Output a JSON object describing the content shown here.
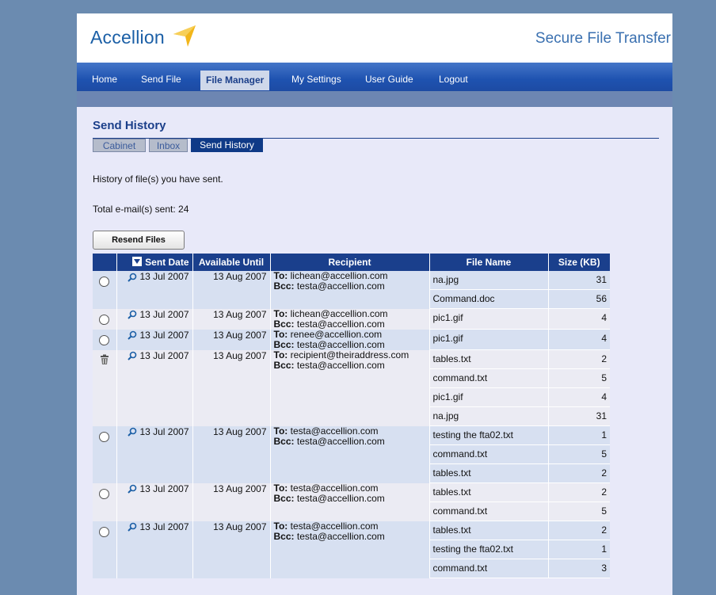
{
  "header": {
    "logo_text": "Accellion",
    "app_title": "Secure File Transfer",
    "brand_blue": "#1b5fa6",
    "logo_accent": "#f2b61a"
  },
  "nav": {
    "items": [
      {
        "label": "Home"
      },
      {
        "label": "Send File"
      },
      {
        "label": "File Manager",
        "active": true
      },
      {
        "label": "My Settings"
      },
      {
        "label": "User Guide"
      },
      {
        "label": "Logout"
      }
    ]
  },
  "page": {
    "title": "Send History",
    "tabs": [
      {
        "label": "Cabinet"
      },
      {
        "label": "Inbox"
      },
      {
        "label": "Send History",
        "active": true
      }
    ],
    "description": "History of file(s) you have sent.",
    "total_label": "Total e-mail(s) sent: 24",
    "resend_label": "Resend Files"
  },
  "table": {
    "columns": {
      "sent_date": "Sent Date",
      "available_until": "Available Until",
      "recipient": "Recipient",
      "file_name": "File Name",
      "size": "Size (KB)"
    },
    "sort_icon": "sort-down-icon",
    "to_label": "To:",
    "bcc_label": "Bcc:",
    "records": [
      {
        "selector": "radio",
        "sent": "13 Jul 2007",
        "available": "13 Aug 2007",
        "to": "lichean@accellion.com",
        "bcc": "testa@accellion.com",
        "files": [
          {
            "name": "na.jpg",
            "size": "31"
          },
          {
            "name": "Command.doc",
            "size": "56"
          }
        ]
      },
      {
        "selector": "radio",
        "sent": "13 Jul 2007",
        "available": "13 Aug 2007",
        "to": "lichean@accellion.com",
        "bcc": "testa@accellion.com",
        "files": [
          {
            "name": "pic1.gif",
            "size": "4"
          }
        ]
      },
      {
        "selector": "radio",
        "sent": "13 Jul 2007",
        "available": "13 Aug 2007",
        "to": "renee@accellion.com",
        "bcc": "testa@accellion.com",
        "files": [
          {
            "name": "pic1.gif",
            "size": "4"
          }
        ]
      },
      {
        "selector": "trash",
        "sent": "13 Jul 2007",
        "available": "13 Aug 2007",
        "to": "recipient@theiraddress.com",
        "bcc": "testa@accellion.com",
        "files": [
          {
            "name": "tables.txt",
            "size": "2"
          },
          {
            "name": "command.txt",
            "size": "5"
          },
          {
            "name": "pic1.gif",
            "size": "4"
          },
          {
            "name": "na.jpg",
            "size": "31"
          }
        ]
      },
      {
        "selector": "radio",
        "sent": "13 Jul 2007",
        "available": "13 Aug 2007",
        "to": "testa@accellion.com",
        "bcc": "testa@accellion.com",
        "files": [
          {
            "name": "testing the fta02.txt",
            "size": "1"
          },
          {
            "name": "command.txt",
            "size": "5"
          },
          {
            "name": "tables.txt",
            "size": "2"
          }
        ]
      },
      {
        "selector": "radio",
        "sent": "13 Jul 2007",
        "available": "13 Aug 2007",
        "to": "testa@accellion.com",
        "bcc": "testa@accellion.com",
        "files": [
          {
            "name": "tables.txt",
            "size": "2"
          },
          {
            "name": "command.txt",
            "size": "5"
          }
        ]
      },
      {
        "selector": "radio",
        "sent": "13 Jul 2007",
        "available": "13 Aug 2007",
        "to": "testa@accellion.com",
        "bcc": "testa@accellion.com",
        "files": [
          {
            "name": "tables.txt",
            "size": "2"
          },
          {
            "name": "testing the fta02.txt",
            "size": "1"
          },
          {
            "name": "command.txt",
            "size": "3"
          }
        ]
      }
    ]
  }
}
